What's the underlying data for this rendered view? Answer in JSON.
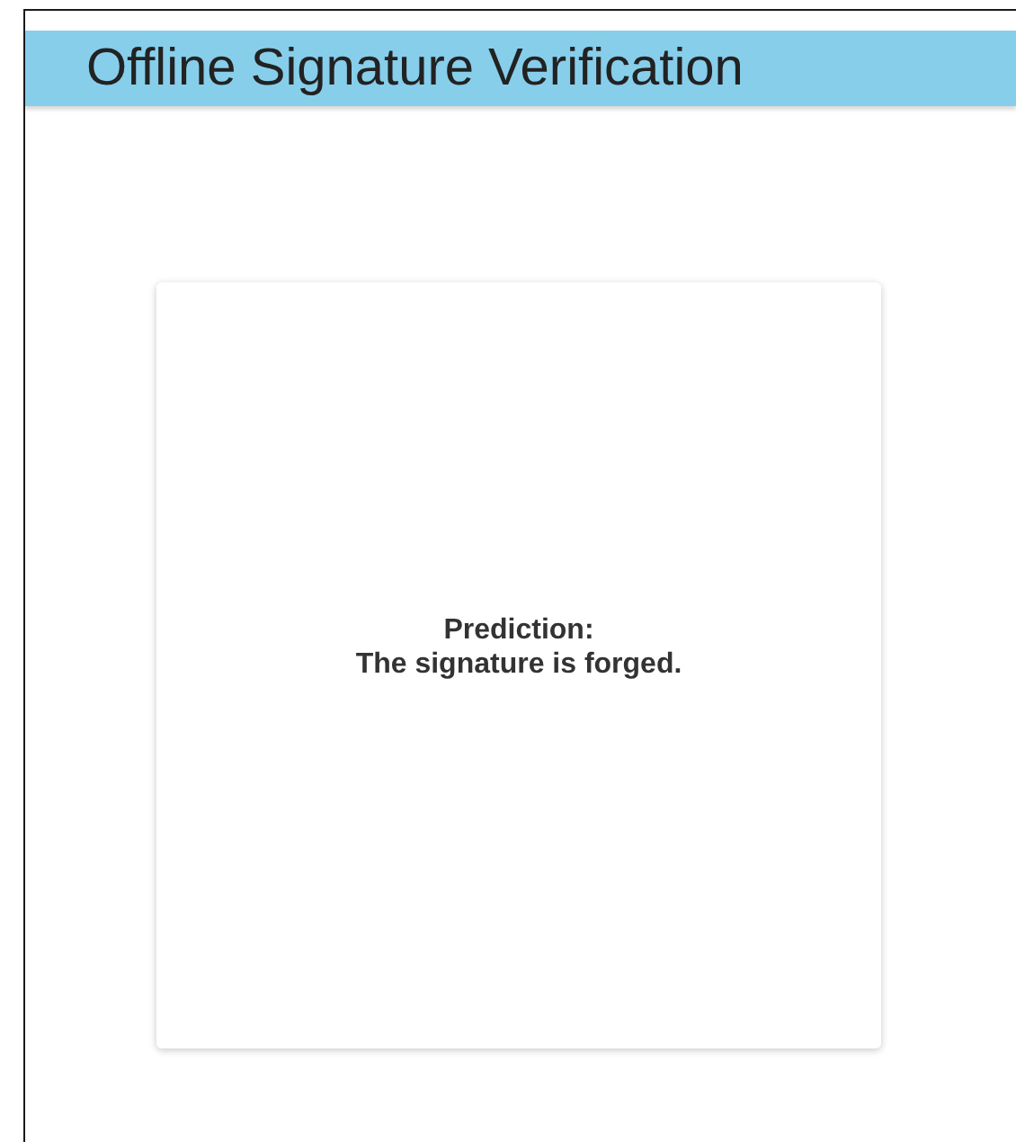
{
  "header": {
    "title": "Offline Signature Verification"
  },
  "result_card": {
    "label": "Prediction:",
    "result": "The signature is forged."
  }
}
